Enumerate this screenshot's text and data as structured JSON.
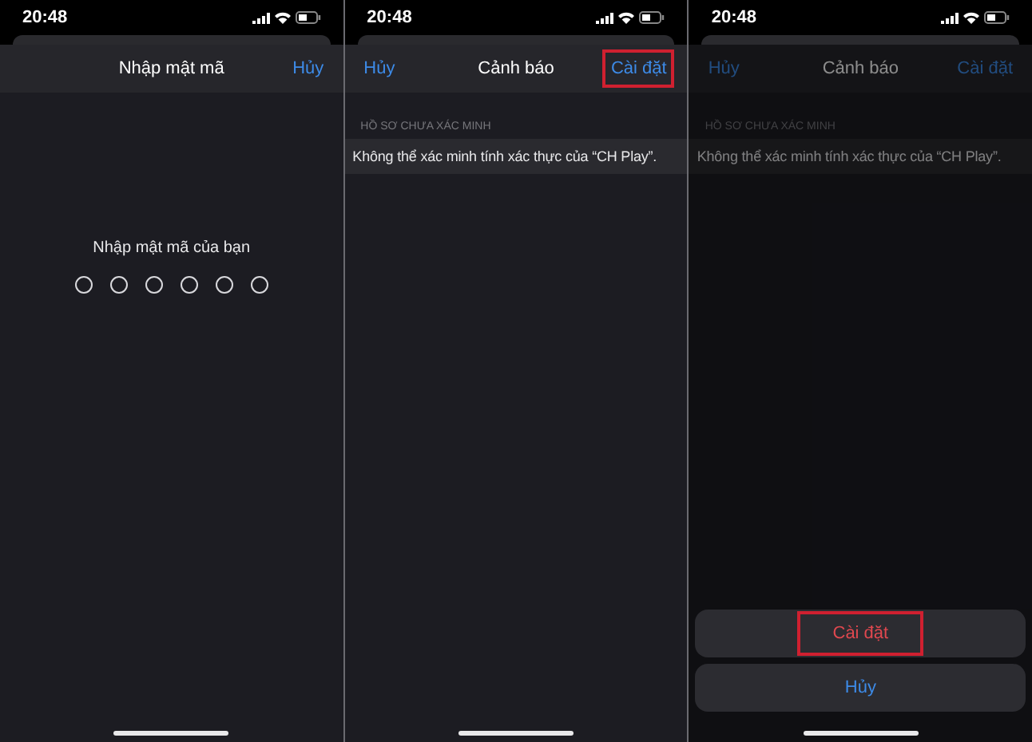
{
  "screens": [
    {
      "kind": "passcode",
      "dimmed": false,
      "time": "20:48",
      "nav": {
        "title": "Nhập mật mã",
        "right": {
          "label": "Hủy",
          "highlighted": false
        }
      },
      "prompt": "Nhập mật mã của bạn",
      "digits": [
        {
          "filled": false
        },
        {
          "filled": false
        },
        {
          "filled": false
        },
        {
          "filled": false
        },
        {
          "filled": false
        },
        {
          "filled": false
        }
      ]
    },
    {
      "kind": "alert",
      "dimmed": false,
      "time": "20:48",
      "nav": {
        "left": {
          "label": "Hủy",
          "highlighted": false
        },
        "title": "Cảnh báo",
        "right": {
          "label": "Cài đặt",
          "highlighted": true
        }
      },
      "section_header": "HỒ SƠ CHƯA XÁC MINH",
      "message": "Không thể xác minh tính xác thực của “CH Play”."
    },
    {
      "kind": "alert",
      "dimmed": true,
      "time": "20:48",
      "nav": {
        "left": {
          "label": "Hủy",
          "highlighted": false
        },
        "title": "Cảnh báo",
        "right": {
          "label": "Cài đặt",
          "highlighted": false
        }
      },
      "section_header": "HỒ SƠ CHƯA XÁC MINH",
      "message": "Không thể xác minh tính xác thực của “CH Play”.",
      "action_sheet": [
        {
          "label": "Cài đặt",
          "destructive": true,
          "highlighted": true
        },
        {
          "label": "Hủy",
          "destructive": false,
          "highlighted": false
        }
      ]
    }
  ]
}
